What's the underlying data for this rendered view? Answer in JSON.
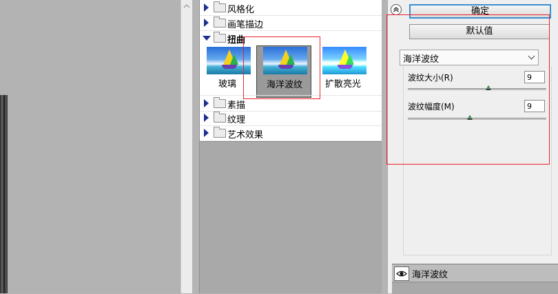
{
  "gallery": {
    "categories_top": [
      {
        "label": "风格化",
        "expanded": false
      },
      {
        "label": "画笔描边",
        "expanded": false
      },
      {
        "label": "扭曲",
        "expanded": true
      }
    ],
    "thumbnails": [
      {
        "label": "玻璃",
        "selected": false
      },
      {
        "label": "海洋波纹",
        "selected": true
      },
      {
        "label": "扩散亮光",
        "selected": false
      }
    ],
    "categories_bottom": [
      {
        "label": "素描",
        "expanded": false
      },
      {
        "label": "纹理",
        "expanded": false
      },
      {
        "label": "艺术效果",
        "expanded": false
      }
    ]
  },
  "settings": {
    "ok_label": "确定",
    "default_label": "默认值",
    "filter_select": "海洋波纹",
    "params": [
      {
        "label": "波纹大小(R)",
        "value": "9",
        "slider_fraction": 0.58
      },
      {
        "label": "波纹幅度(M)",
        "value": "9",
        "slider_fraction": 0.45
      }
    ],
    "layer_name": "海洋波纹"
  },
  "colors": {
    "highlight": "#e8222b",
    "accent": "#3a8ed0",
    "folder_triangle": "#1d2f8f"
  }
}
